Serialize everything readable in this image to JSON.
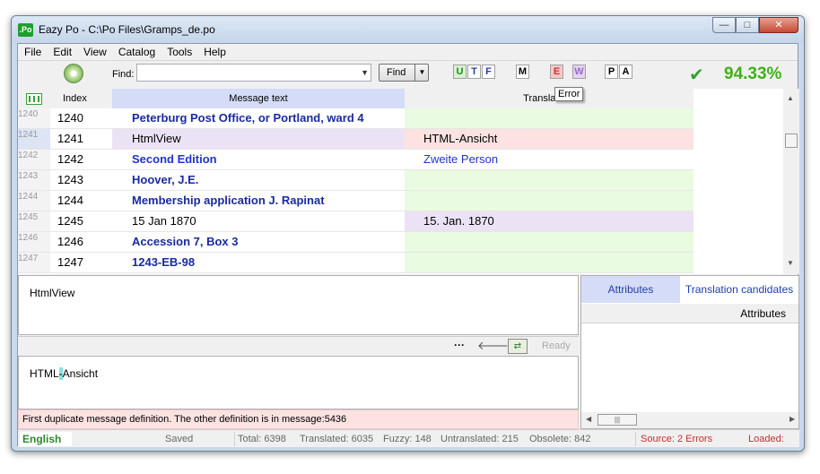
{
  "window": {
    "app_icon": ".Po",
    "title": "Eazy Po - C:\\Po Files\\Gramps_de.po",
    "controls": {
      "minimize": "—",
      "maximize": "□",
      "close": "✕"
    }
  },
  "menu": [
    "File",
    "Edit",
    "View",
    "Catalog",
    "Tools",
    "Help"
  ],
  "toolbar": {
    "find_label": "Find:",
    "find_value": "",
    "find_button": "Find",
    "filters": [
      {
        "label": "U",
        "color": "#1f8a1f",
        "bg": "#d9f2d2"
      },
      {
        "label": "T",
        "color": "#1e3fa8",
        "bg": "#ffffff"
      },
      {
        "label": "F",
        "color": "#1e3fa8",
        "bg": "#ffffff"
      },
      {
        "label": "M",
        "color": "#000000",
        "bg": "#ffffff"
      },
      {
        "label": "E",
        "color": "#cc3333",
        "bg": "#f8c6c6"
      },
      {
        "label": "W",
        "color": "#9a6ac6",
        "bg": "#e6d2f5"
      },
      {
        "label": "P",
        "color": "#000000",
        "bg": "#ffffff"
      },
      {
        "label": "A",
        "color": "#000000",
        "bg": "#ffffff"
      }
    ],
    "tooltip": "Error",
    "percent": "94.33%"
  },
  "grid": {
    "headers": {
      "index": "Index",
      "message": "Message text",
      "translated": "Translated t"
    },
    "rows": [
      {
        "num": "1240",
        "index": "1240",
        "msg": "Peterburg Post Office, or Portland, ward 4",
        "tr": "",
        "msg_style": "untranslated",
        "tr_bg": "#e9fbe0",
        "msg_bg": "#ffffff"
      },
      {
        "num": "1241",
        "index": "1241",
        "msg": "HtmlView",
        "tr": "HTML-Ansicht",
        "msg_style": "normal",
        "tr_bg": "#fde2e2",
        "msg_bg": "#ece2f5",
        "selected": true
      },
      {
        "num": "1242",
        "index": "1242",
        "msg": "Second Edition",
        "tr": "Zweite Person",
        "msg_style": "fuzzy",
        "tr_bg": "#ffffff",
        "msg_bg": "#ffffff"
      },
      {
        "num": "1243",
        "index": "1243",
        "msg": "Hoover, J.E.",
        "tr": "",
        "msg_style": "untranslated",
        "tr_bg": "#e9fbe0",
        "msg_bg": "#ffffff"
      },
      {
        "num": "1244",
        "index": "1244",
        "msg": "Membership application J. Rapinat",
        "tr": "",
        "msg_style": "untranslated",
        "tr_bg": "#e9fbe0",
        "msg_bg": "#ffffff"
      },
      {
        "num": "1245",
        "index": "1245",
        "msg": "15 Jan 1870",
        "tr": "15. Jan. 1870",
        "msg_style": "normal",
        "tr_bg": "#ece2f5",
        "msg_bg": "#ffffff"
      },
      {
        "num": "1246",
        "index": "1246",
        "msg": "Accession 7, Box 3",
        "tr": "",
        "msg_style": "untranslated",
        "tr_bg": "#e9fbe0",
        "msg_bg": "#ffffff"
      },
      {
        "num": "1247",
        "index": "1247",
        "msg": "1243-EB-98",
        "tr": "",
        "msg_style": "untranslated",
        "tr_bg": "#e9fbe0",
        "msg_bg": "#ffffff"
      }
    ]
  },
  "source": {
    "text": "HtmlView"
  },
  "edit_toolbar": {
    "dots": "···",
    "back": "🡐",
    "box": "⇄",
    "status": "Ready"
  },
  "target": {
    "before": "HTML",
    "highlight": "-",
    "after": "Ansicht"
  },
  "error_message": "First duplicate message definition. The other definition is in message:5436",
  "right_pane": {
    "tab_attributes": "Attributes",
    "tab_candidates": "Translation candidates",
    "column_header": "Attributes"
  },
  "status": {
    "language": "English",
    "saved": "Saved",
    "total": "Total: 6398",
    "translated": "Translated: 6035",
    "fuzzy": "Fuzzy: 148",
    "untranslated": "Untranslated: 215",
    "obsolete": "Obsolete: 842",
    "source": "Source: 2 Errors",
    "loaded": "Loaded:"
  }
}
